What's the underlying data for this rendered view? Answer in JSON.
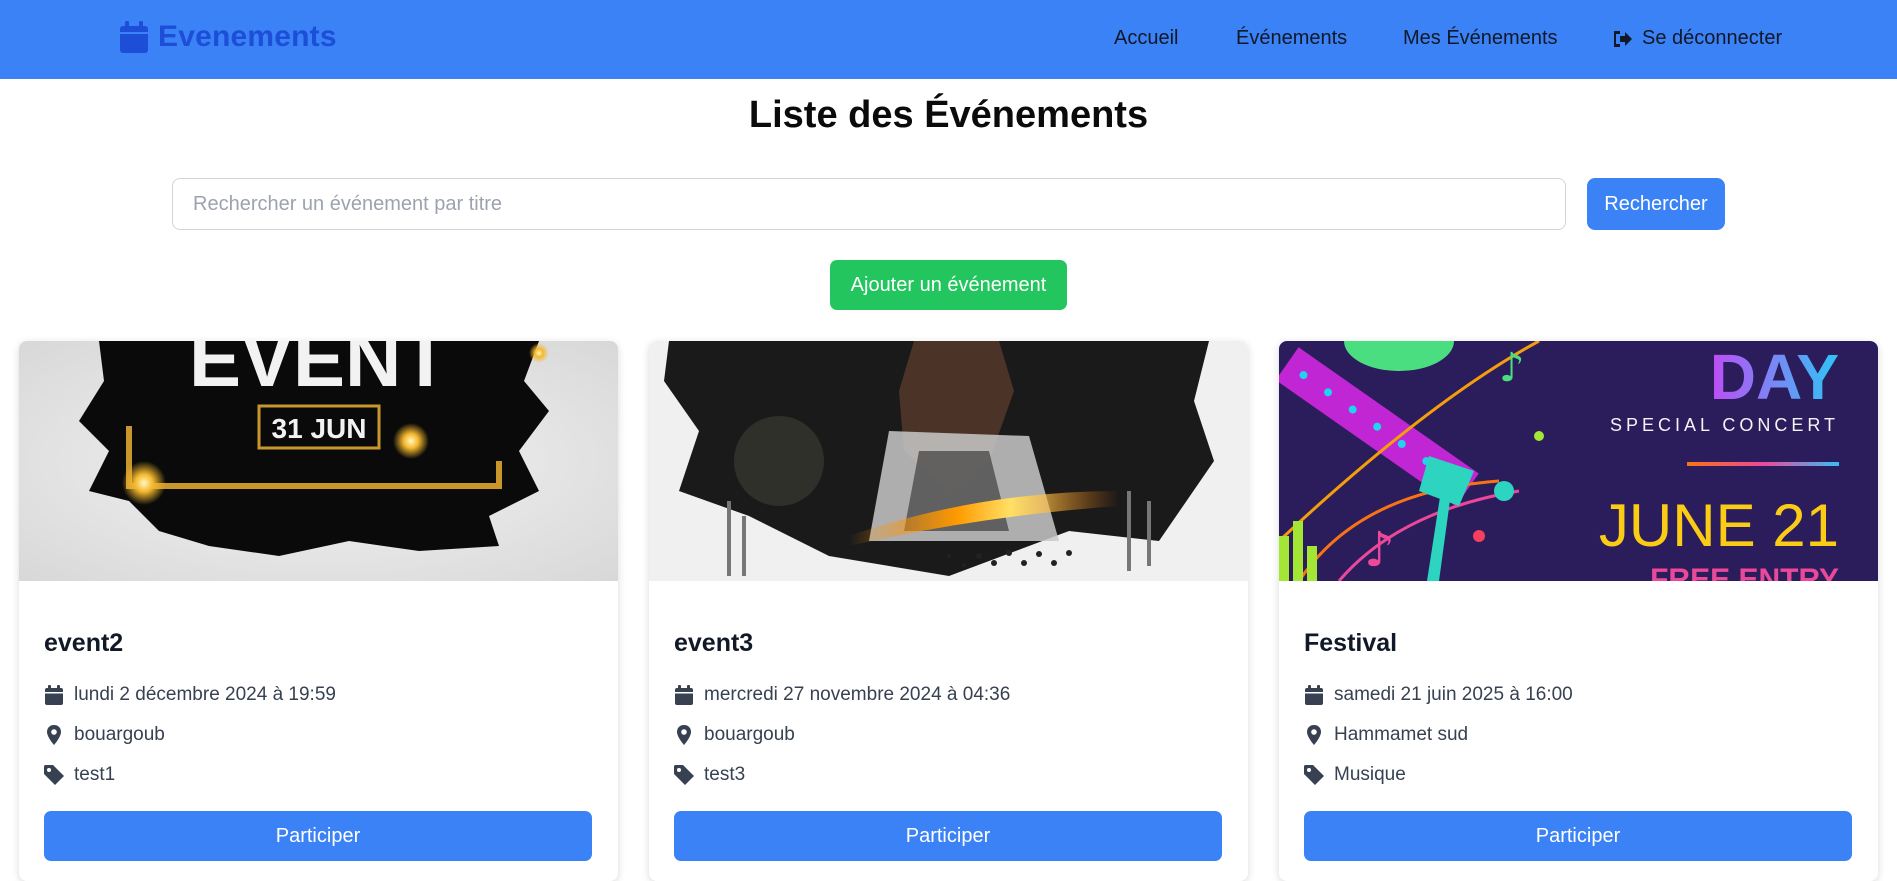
{
  "brand": {
    "name": "Evenements",
    "icon": "calendar-icon"
  },
  "nav": {
    "home": "Accueil",
    "events": "Événements",
    "my_events": "Mes Événements",
    "logout": "Se déconnecter"
  },
  "page": {
    "title": "Liste des Événements"
  },
  "search": {
    "placeholder": "Rechercher un événement par titre",
    "value": "",
    "button": "Rechercher"
  },
  "add_button": "Ajouter un événement",
  "events": [
    {
      "title": "event2",
      "date": "lundi 2 décembre 2024 à 19:59",
      "location": "bouargoub",
      "category": "test1",
      "button": "Participer",
      "image_text": [
        "EVENT",
        "31 JUN"
      ]
    },
    {
      "title": "event3",
      "date": "mercredi 27 novembre 2024 à 04:36",
      "location": "bouargoub",
      "category": "test3",
      "button": "Participer"
    },
    {
      "title": "Festival",
      "date": "samedi 21 juin 2025 à 16:00",
      "location": "Hammamet sud",
      "category": "Musique",
      "button": "Participer",
      "image_text": [
        "DAY",
        "SPECIAL CONCERT",
        "JUNE 21",
        "FREE ENTRY"
      ]
    }
  ],
  "colors": {
    "primary": "#3b82f6",
    "brand_text": "#1d4ed8",
    "success": "#22c55e"
  }
}
